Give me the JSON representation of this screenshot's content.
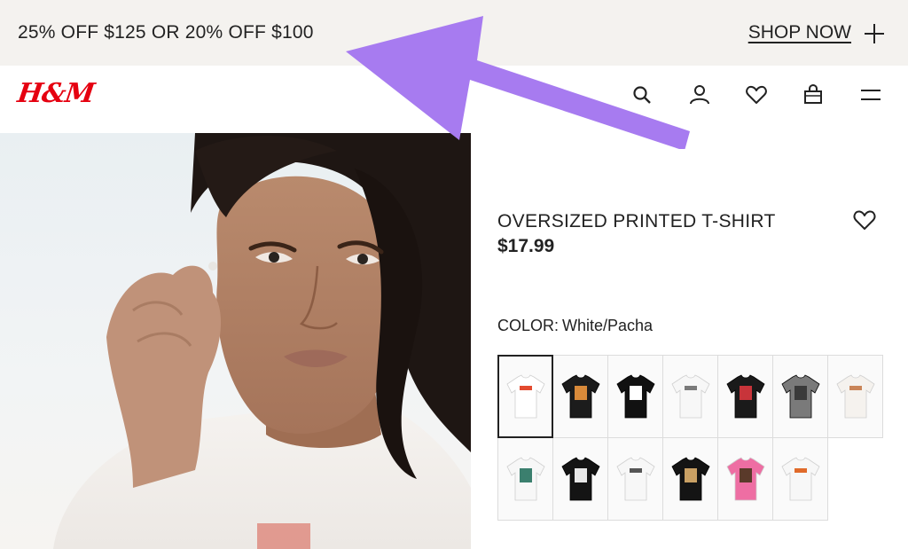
{
  "promo": {
    "text": "25% OFF $125 OR 20% OFF $100",
    "cta": "SHOP NOW"
  },
  "header": {
    "logo": "H&M",
    "icons": [
      "search-icon",
      "account-icon",
      "favorites-icon",
      "bag-icon",
      "menu-icon"
    ]
  },
  "product": {
    "title": "OVERSIZED PRINTED T-SHIRT",
    "price": "$17.99",
    "color_label": "COLOR:",
    "color_value": "White/Pacha"
  },
  "swatches": [
    {
      "shirt": "#ffffff",
      "print": "#e34a2f",
      "dark": false,
      "selected": true
    },
    {
      "shirt": "#1c1c1c",
      "print": "#d98a3a",
      "dark": true,
      "selected": false
    },
    {
      "shirt": "#111111",
      "print": "#ffffff",
      "dark": true,
      "selected": false
    },
    {
      "shirt": "#f7f7f7",
      "print": "#7a7a7a",
      "dark": false,
      "selected": false
    },
    {
      "shirt": "#1a1a1a",
      "print": "#c8343a",
      "dark": true,
      "selected": false
    },
    {
      "shirt": "#7a7a7a",
      "print": "#3a3a3a",
      "dark": true,
      "selected": false
    },
    {
      "shirt": "#f5f2ee",
      "print": "#c98457",
      "dark": false,
      "selected": false
    },
    {
      "shirt": "#f7f7f7",
      "print": "#3b7f6e",
      "dark": false,
      "selected": false
    },
    {
      "shirt": "#141414",
      "print": "#e8e8e8",
      "dark": true,
      "selected": false
    },
    {
      "shirt": "#f7f7f7",
      "print": "#555555",
      "dark": false,
      "selected": false
    },
    {
      "shirt": "#141414",
      "print": "#c9a064",
      "dark": true,
      "selected": false
    },
    {
      "shirt": "#ee6ea3",
      "print": "#5a3a2a",
      "dark": false,
      "selected": false
    },
    {
      "shirt": "#f7f7f7",
      "print": "#e06a2a",
      "dark": false,
      "selected": false
    }
  ],
  "annotation": {
    "arrow_color": "#a77bf0"
  }
}
